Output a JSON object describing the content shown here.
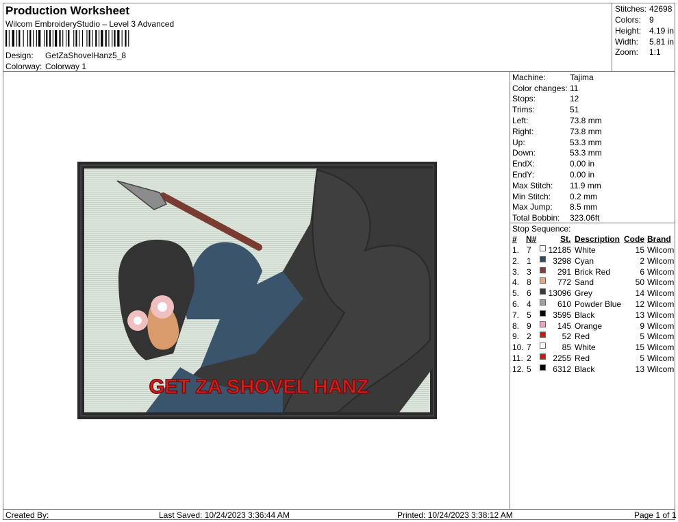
{
  "header": {
    "title": "Production Worksheet",
    "subtitle": "Wilcom EmbroideryStudio – Level 3 Advanced",
    "design_label": "Design:",
    "design_value": "GetZaShovelHanz5_8",
    "colorway_label": "Colorway:",
    "colorway_value": "Colorway 1"
  },
  "stats": [
    {
      "label": "Stitches:",
      "value": "42698"
    },
    {
      "label": "Colors:",
      "value": "9"
    },
    {
      "label": "Height:",
      "value": "4.19 in"
    },
    {
      "label": "Width:",
      "value": "5.81 in"
    },
    {
      "label": "Zoom:",
      "value": "1:1"
    }
  ],
  "machine": [
    {
      "label": "Machine:",
      "value": "Tajima"
    },
    {
      "label": "Color changes:",
      "value": "11"
    },
    {
      "label": "Stops:",
      "value": "12"
    },
    {
      "label": "Trims:",
      "value": "51"
    },
    {
      "label": "Left:",
      "value": "73.8 mm"
    },
    {
      "label": "Right:",
      "value": "73.8 mm"
    },
    {
      "label": "Up:",
      "value": "53.3 mm"
    },
    {
      "label": "Down:",
      "value": "53.3 mm"
    },
    {
      "label": "EndX:",
      "value": "0.00 in"
    },
    {
      "label": "EndY:",
      "value": "0.00 in"
    },
    {
      "label": "Max Stitch:",
      "value": "11.9 mm"
    },
    {
      "label": "Min Stitch:",
      "value": "0.2 mm"
    },
    {
      "label": "Max Jump:",
      "value": "8.5 mm"
    },
    {
      "label": "Total Bobbin:",
      "value": "323.06ft"
    }
  ],
  "stop_sequence": {
    "title": "Stop Sequence:",
    "headers": {
      "num": "#",
      "n": "N#",
      "st": "St.",
      "desc": "Description",
      "code": "Code",
      "brand": "Brand"
    },
    "rows": [
      {
        "num": "1.",
        "n": "7",
        "color": "#ffffff",
        "st": "12185",
        "desc": "White",
        "code": "15",
        "brand": "Wilcom"
      },
      {
        "num": "2.",
        "n": "1",
        "color": "#2f4e64",
        "st": "3298",
        "desc": "Cyan",
        "code": "2",
        "brand": "Wilcom"
      },
      {
        "num": "3.",
        "n": "3",
        "color": "#8a3a3a",
        "st": "291",
        "desc": "Brick Red",
        "code": "6",
        "brand": "Wilcom"
      },
      {
        "num": "4.",
        "n": "8",
        "color": "#e8a87c",
        "st": "772",
        "desc": "Sand",
        "code": "50",
        "brand": "Wilcom"
      },
      {
        "num": "5.",
        "n": "6",
        "color": "#3a3a3a",
        "st": "13096",
        "desc": "Grey",
        "code": "14",
        "brand": "Wilcom"
      },
      {
        "num": "6.",
        "n": "4",
        "color": "#a0a0a0",
        "st": "610",
        "desc": "Powder Blue",
        "code": "12",
        "brand": "Wilcom"
      },
      {
        "num": "7.",
        "n": "5",
        "color": "#000000",
        "st": "3595",
        "desc": "Black",
        "code": "13",
        "brand": "Wilcom"
      },
      {
        "num": "8.",
        "n": "9",
        "color": "#f59cc6",
        "st": "145",
        "desc": "Orange",
        "code": "9",
        "brand": "Wilcom"
      },
      {
        "num": "9.",
        "n": "2",
        "color": "#e01010",
        "st": "52",
        "desc": "Red",
        "code": "5",
        "brand": "Wilcom"
      },
      {
        "num": "10.",
        "n": "7",
        "color": "#ffffff",
        "st": "85",
        "desc": "White",
        "code": "15",
        "brand": "Wilcom"
      },
      {
        "num": "11.",
        "n": "2",
        "color": "#e01010",
        "st": "2255",
        "desc": "Red",
        "code": "5",
        "brand": "Wilcom"
      },
      {
        "num": "12.",
        "n": "5",
        "color": "#000000",
        "st": "6312",
        "desc": "Black",
        "code": "13",
        "brand": "Wilcom"
      }
    ]
  },
  "design_image": {
    "caption": "GET ZA SHOVEL HANZ"
  },
  "footer": {
    "created_by": "Created By:",
    "last_saved": "Last Saved: 10/24/2023 3:36:44 AM",
    "printed": "Printed: 10/24/2023 3:38:12 AM",
    "page": "Page 1 of 1"
  }
}
